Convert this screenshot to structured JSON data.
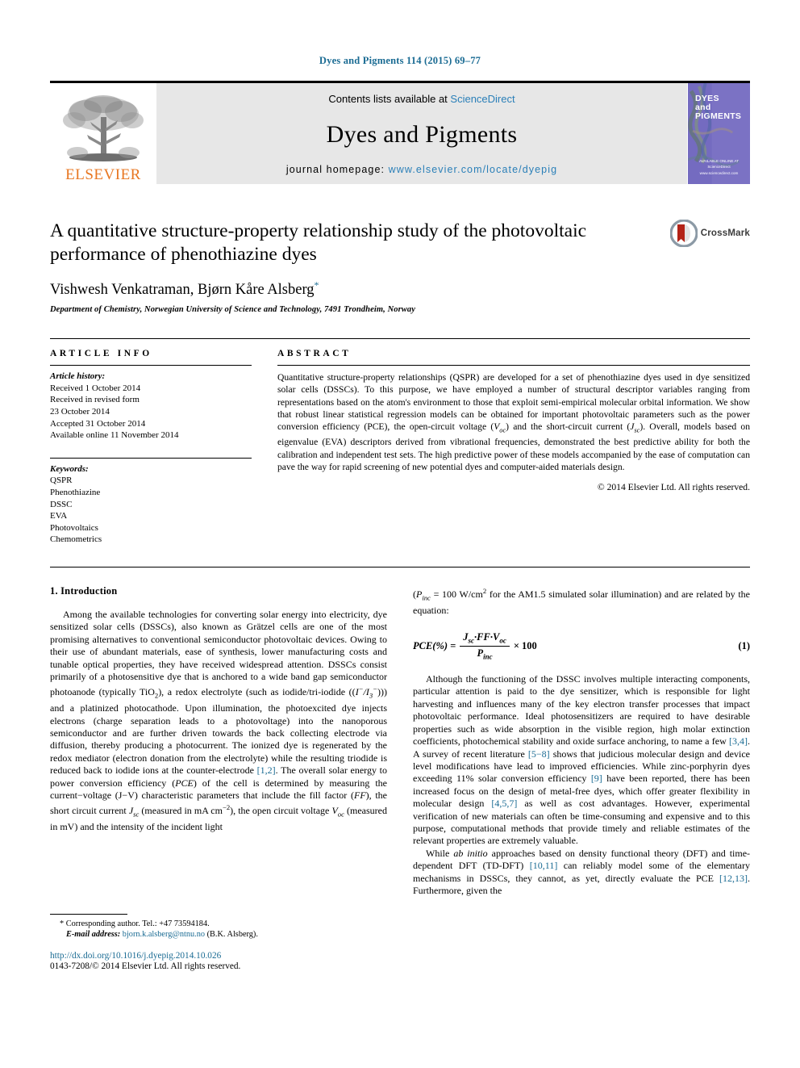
{
  "running_head": "Dyes and Pigments 114 (2015) 69–77",
  "masthead": {
    "publisher_name": "ELSEVIER",
    "contents_prefix": "Contents lists available at ",
    "contents_link": "ScienceDirect",
    "journal_title": "Dyes and Pigments",
    "homepage_prefix": "journal homepage: ",
    "homepage_url": "www.elsevier.com/locate/dyepig",
    "cover_title_line1": "DYES",
    "cover_title_line2": "and",
    "cover_title_line3": "PIGMENTS",
    "cover_footer_line1": "AVAILABLE ONLINE AT",
    "cover_footer_line2": "ScienceDirect",
    "cover_footer_line3": "www.sciencedirect.com"
  },
  "article": {
    "title": "A quantitative structure-property relationship study of the photovoltaic performance of phenothiazine dyes",
    "authors": "Vishwesh Venkatraman, Bjørn Kåre Alsberg",
    "corresponding_marker": "*",
    "affiliation": "Department of Chemistry, Norwegian University of Science and Technology, 7491 Trondheim, Norway",
    "crossmark_label": "CrossMark"
  },
  "article_info": {
    "heading": "ARTICLE INFO",
    "history_label": "Article history:",
    "history": [
      "Received 1 October 2014",
      "Received in revised form",
      "23 October 2014",
      "Accepted 31 October 2014",
      "Available online 11 November 2014"
    ],
    "keywords_label": "Keywords:",
    "keywords": [
      "QSPR",
      "Phenothiazine",
      "DSSC",
      "EVA",
      "Photovoltaics",
      "Chemometrics"
    ]
  },
  "abstract": {
    "heading": "ABSTRACT",
    "paragraph_1": "Quantitative structure-property relationships (QSPR) are developed for a set of phenothiazine dyes used in dye sensitized solar cells (DSSCs). To this purpose, we have employed a number of structural descriptor variables ranging from representations based on the atom's environment to those that exploit semi-empirical molecular orbital information. We show that robust linear statistical regression models can be obtained for important photovoltaic parameters such as the power conversion efficiency (PCE), the open-circuit voltage (",
    "voc_symbol": "V",
    "voc_sub": "oc",
    "paragraph_2": ") and the short-circuit current (",
    "jsc_symbol": "J",
    "jsc_sub": "sc",
    "paragraph_3": "). Overall, models based on eigenvalue (EVA) descriptors derived from vibrational frequencies, demonstrated the best predictive ability for both the calibration and independent test sets. The high predictive power of these models accompanied by the ease of computation can pave the way for rapid screening of new potential dyes and computer-aided materials design.",
    "copyright": "© 2014 Elsevier Ltd. All rights reserved."
  },
  "body": {
    "section_number_title": "1. Introduction",
    "left_para_1_a": "Among the available technologies for converting solar energy into electricity, dye sensitized solar cells (DSSCs), also known as Grätzel cells are one of the most promising alternatives to conventional semiconductor photovoltaic devices. Owing to their use of abundant materials, ease of synthesis, lower manufacturing costs and tunable optical properties, they have received widespread attention. DSSCs consist primarily of a photosensitive dye that is anchored to a wide band gap semiconductor photoanode (typically TiO",
    "tio2_sub": "2",
    "left_para_1_b": "), a redox electrolyte (such as iodide/tri-iodide ((",
    "iodide_i": "I",
    "iodide_sup1": "−",
    "iodide_slash": "/I",
    "iodide_sub3": "3",
    "iodide_sup2": "−",
    "left_para_1_c": "))) and a platinized photocathode. Upon illumination, the photoexcited dye injects electrons (charge separation leads to a photovoltage) into the nanoporous semiconductor and are further driven towards the back collecting electrode via diffusion, thereby producing a photocurrent. The ionized dye is regenerated by the redox mediator (electron donation from the electrolyte) while the resulting triodide is reduced back to iodide ions at the counter-electrode ",
    "ref_1_2": "[1,2]",
    "left_para_1_d": ". The overall solar energy to power conversion efficiency (",
    "pce_italic": "PCE",
    "left_para_1_e": ") of the cell is determined by measuring the current−voltage (J−V) characteristic parameters that include the fill factor (",
    "ff_italic": "FF",
    "left_para_1_f": "), the short circuit current ",
    "jsc_italic": "J",
    "jsc_italic_sub": "sc",
    "left_para_1_g": " (measured in mA cm",
    "cm_sup": "−2",
    "left_para_1_h": "), the open circuit voltage ",
    "voc_italic": "V",
    "voc_italic_sub": "oc",
    "left_para_1_i": " (measured in mV) and the intensity of the incident light",
    "right_para_0_a": "(",
    "pinc_italic": "P",
    "pinc_sub": "inc",
    "right_para_0_b": " = 100 W/cm",
    "wcm_sup": "2",
    "right_para_0_c": " for the AM1.5 simulated solar illumination) and are related by the equation:",
    "equation": {
      "lhs": "PCE(%) =",
      "numerator": "J",
      "numerator_sub": "sc",
      "numerator_rest": "·FF·V",
      "numerator_sub2": "oc",
      "denominator": "P",
      "denominator_sub": "inc",
      "multiplier": "× 100",
      "number": "(1)"
    },
    "right_para_1_a": "Although the functioning of the DSSC involves multiple interacting components, particular attention is paid to the dye sensitizer, which is responsible for light harvesting and influences many of the key electron transfer processes that impact photovoltaic performance. Ideal photosensitizers are required to have desirable properties such as wide absorption in the visible region, high molar extinction coefficients, photochemical stability and oxide surface anchoring, to name a few ",
    "ref_3_4": "[3,4]",
    "right_para_1_b": ". A survey of recent literature ",
    "ref_5_8": "[5−8]",
    "right_para_1_c": " shows that judicious molecular design and device level modifications have lead to improved efficiencies. While zinc-porphyrin dyes exceeding 11% solar conversion efficiency ",
    "ref_9": "[9]",
    "right_para_1_d": " have been reported, there has been increased focus on the design of metal-free dyes, which offer greater flexibility in molecular design ",
    "ref_4_5_7": "[4,5,7]",
    "right_para_1_e": " as well as cost advantages. However, experimental verification of new materials can often be time-consuming and expensive and to this purpose, computational methods that provide timely and reliable estimates of the relevant properties are extremely valuable.",
    "right_para_2_a": "While ",
    "ab_initio": "ab initio",
    "right_para_2_b": " approaches based on density functional theory (DFT) and time-dependent DFT (TD-DFT) ",
    "ref_10_11": "[10,11]",
    "right_para_2_c": " can reliably model some of the elementary mechanisms in DSSCs, they cannot, as yet, directly evaluate the PCE ",
    "ref_12_13": "[12,13]",
    "right_para_2_d": ". Furthermore, given the"
  },
  "footer": {
    "corr_marker": "*",
    "corr_text": "Corresponding author. Tel.: +47 73594184.",
    "email_label": "E-mail address:",
    "email": "bjorn.k.alsberg@ntnu.no",
    "email_suffix": "(B.K. Alsberg).",
    "doi": "http://dx.doi.org/10.1016/j.dyepig.2014.10.026",
    "issn": "0143-7208/© 2014 Elsevier Ltd. All rights reserved."
  },
  "colors": {
    "link_blue": "#1a6b93",
    "sciencedirect_blue": "#2a7fb8",
    "elsevier_orange": "#E87722",
    "cover_purple": "#7b72c4",
    "crossmark_red": "#b32317"
  }
}
